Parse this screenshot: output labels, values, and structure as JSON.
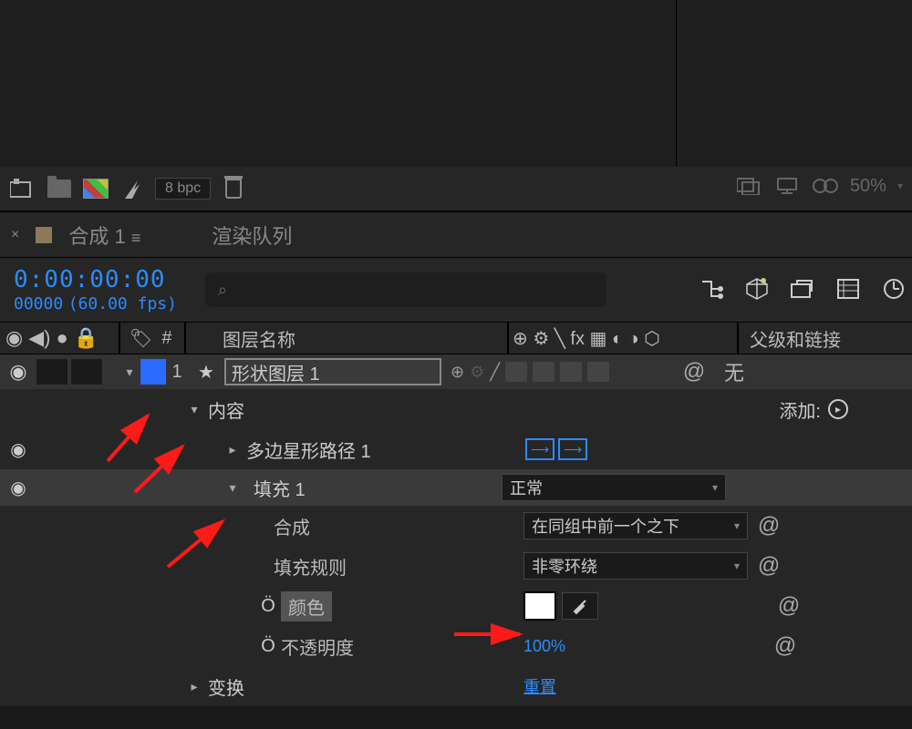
{
  "footer": {
    "bpc": "8 bpc",
    "zoom": "50%"
  },
  "tabs": {
    "close": "×",
    "comp_name": "合成 1",
    "menu_glyph": "≡",
    "render_queue": "渲染队列"
  },
  "timecode": {
    "time": "0:00:00:00",
    "frame": "00000",
    "fps": "(60.00 fps)"
  },
  "headers": {
    "layer_name": "图层名称",
    "switches_glyphs": "⊕ ⚙ ╲ fx ▦ ◐ ◑ ⬡",
    "parent_link": "父级和链接",
    "hash": "#"
  },
  "layer": {
    "index": "1",
    "star": "★",
    "name": "形状图层 1",
    "none": "无"
  },
  "props": {
    "contents": "内容",
    "add": "添加:",
    "polystar": "多边星形路径 1",
    "fill": "填充 1",
    "blend_mode": "正常",
    "composite_label": "合成",
    "composite_value": "在同组中前一个之下",
    "fill_rule_label": "填充规则",
    "fill_rule_value": "非零环绕",
    "color_label": "颜色",
    "opacity_label": "不透明度",
    "opacity_value": "100%",
    "transform": "变换",
    "reset": "重置"
  },
  "glyphs": {
    "eye": "◉",
    "speaker": "◀)",
    "solo": "●",
    "lock": "🔒",
    "tag": "🏷",
    "pickwhip": "⌖",
    "spiral": "@",
    "chevron_down": "▾",
    "chevron_right": "▸",
    "stopwatch": "Ö",
    "search": "⌕"
  }
}
